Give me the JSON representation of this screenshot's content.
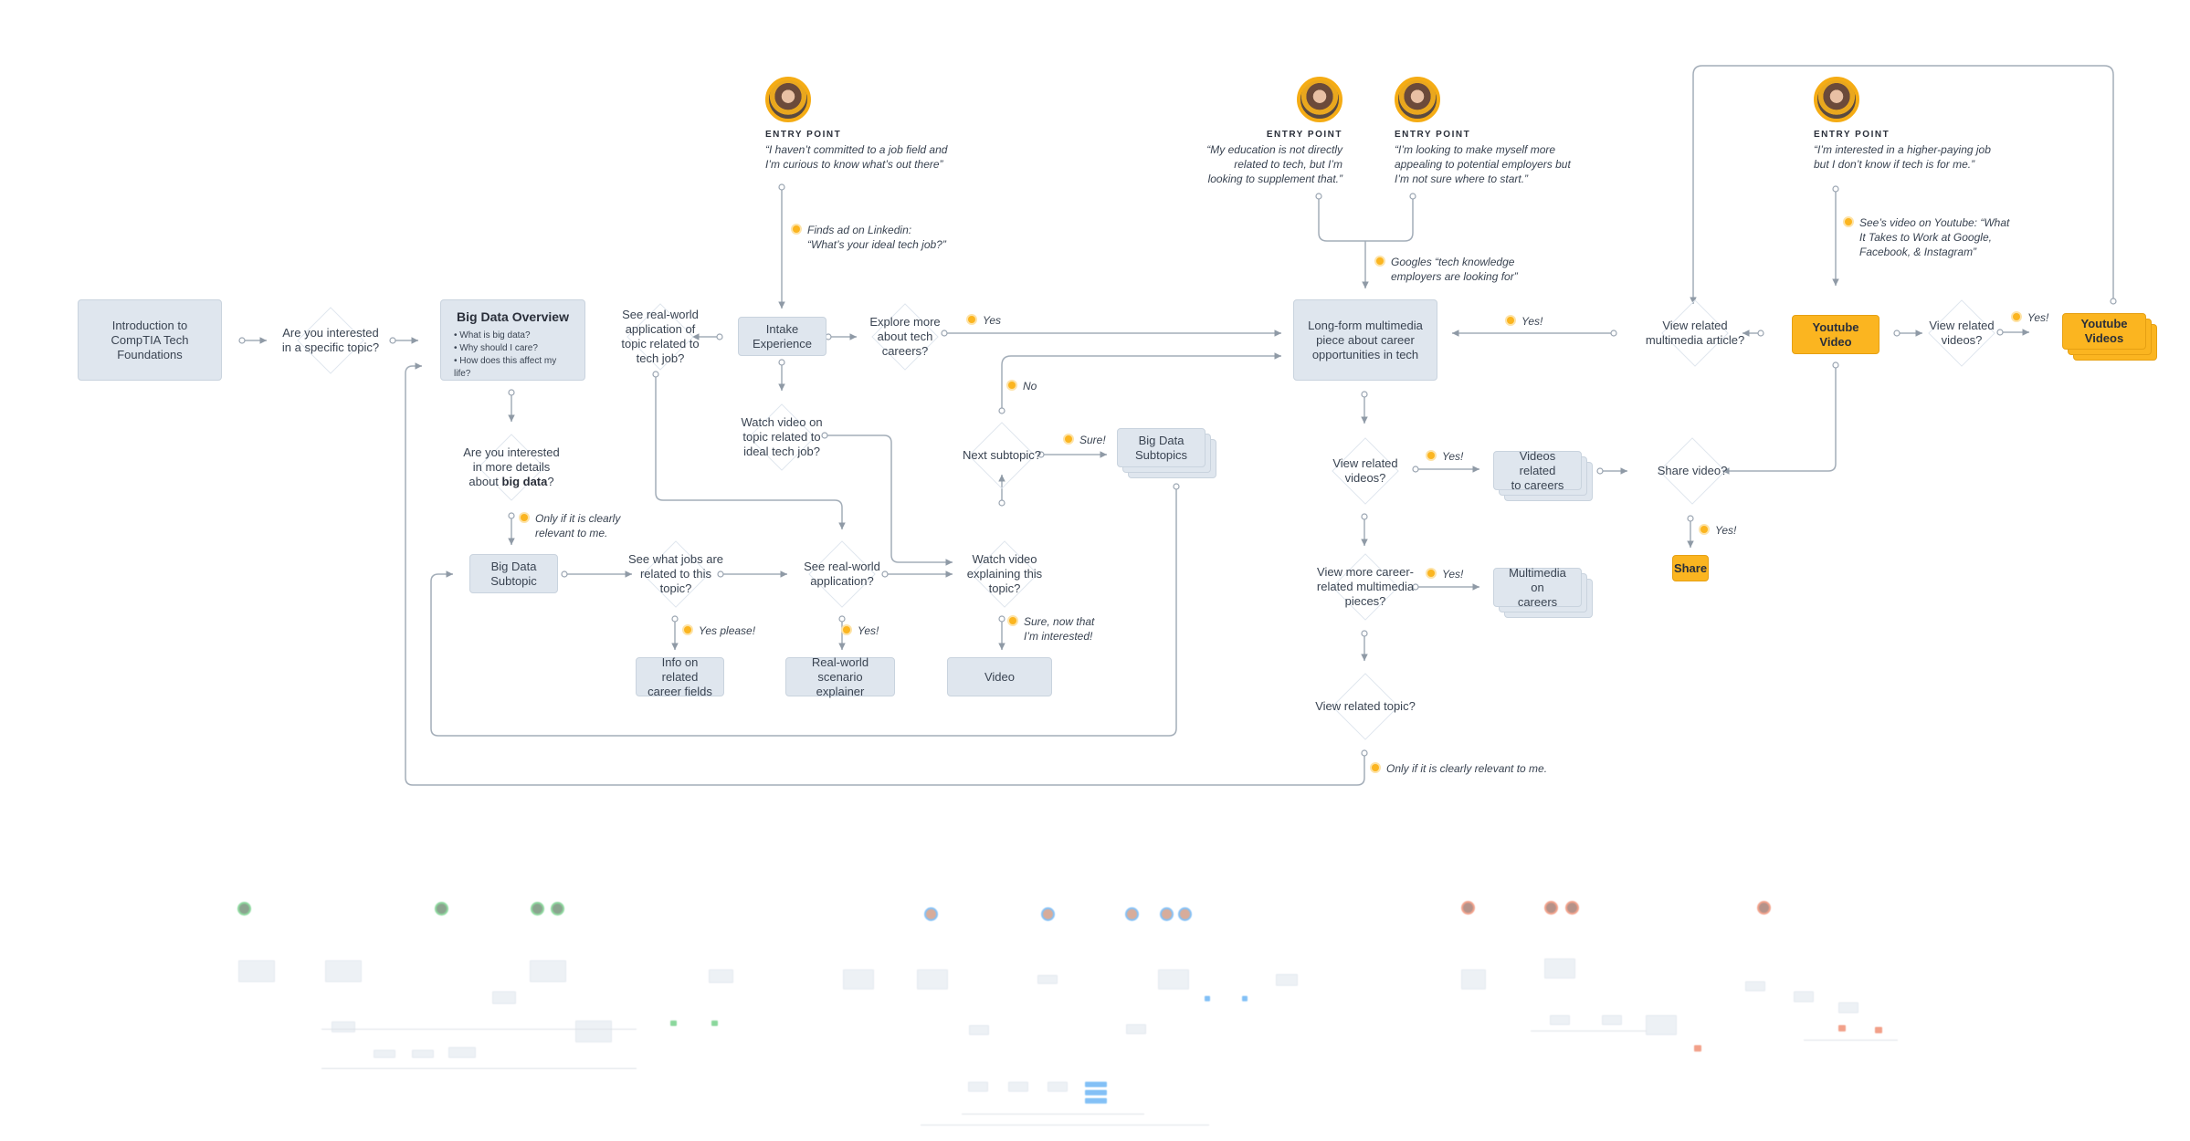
{
  "diagram": {
    "entry_points": [
      {
        "heading": "ENTRY POINT",
        "quote_lines": [
          "“I haven’t committed to a job field and",
          "I’m curious to know what’s out there”"
        ]
      },
      {
        "heading": "ENTRY POINT",
        "quote_lines": [
          "“My education is not directly",
          "related to tech, but I’m",
          "looking to supplement that.”"
        ]
      },
      {
        "heading": "ENTRY POINT",
        "quote_lines": [
          "“I’m looking to make myself more",
          "appealing to potential employers but",
          "I’m not sure where to start.”"
        ]
      },
      {
        "heading": "ENTRY POINT",
        "quote_lines": [
          "“I’m interested in a higher-paying job",
          "but I don’t know if tech is for me.”"
        ]
      }
    ],
    "nodes": {
      "intro": [
        "Introduction to",
        "CompTIA Tech",
        "Foundations"
      ],
      "overview_title": "Big Data Overview",
      "overview_bullets": [
        "What is big data?",
        "Why should I care?",
        "How does this affect my life?"
      ],
      "intake": [
        "Intake",
        "Experience"
      ],
      "bd_subtopic": [
        "Big Data",
        "Subtopic"
      ],
      "bd_subtopics": [
        "Big Data",
        "Subtopics"
      ],
      "info_careers": [
        "Info on related",
        "career fields"
      ],
      "realworld_explainer": [
        "Real-world",
        "scenario explainer"
      ],
      "video": "Video",
      "longform": [
        "Long-form multimedia",
        "piece about career",
        "opportunities in tech"
      ],
      "videos_careers": [
        "Videos related",
        "to careers"
      ],
      "multimedia_careers": [
        "Multimedia on",
        "careers"
      ],
      "youtube_video": "Youtube Video",
      "youtube_videos": "Youtube Videos",
      "share": "Share"
    },
    "decisions": {
      "specific_topic": [
        "Are you interested",
        "in a specific topic?"
      ],
      "more_details": [
        "Are you interested",
        "in more details",
        "about "
      ],
      "more_details_bold": "big data",
      "more_details_end": "?",
      "see_realworld_tech": [
        "See real-world",
        "application of",
        "topic related to",
        "tech job?"
      ],
      "explore_more": [
        "Explore more",
        "about tech",
        "careers?"
      ],
      "watch_video_ideal": [
        "Watch video on",
        "topic related to",
        "ideal tech job?"
      ],
      "next_subtopic": "Next subtopic?",
      "see_jobs": [
        "See what jobs are",
        "related to this",
        "topic?"
      ],
      "see_realworld": [
        "See real-world",
        "application?"
      ],
      "watch_explaining": [
        "Watch video",
        "explaining this",
        "topic?"
      ],
      "view_related_videos": [
        "View related",
        "videos?"
      ],
      "view_more_career": [
        "View more career-",
        "related multimedia",
        "pieces?"
      ],
      "view_related_topic": "View related topic?",
      "view_related_article": [
        "View related",
        "multimedia article?"
      ],
      "share_video": "Share video?",
      "view_related_videos_yt": [
        "View related",
        "videos?"
      ]
    },
    "labels": {
      "finds_ad": [
        "Finds ad on Linkedin:",
        "“What’s your ideal tech job?”"
      ],
      "googles": [
        "Googles “tech knowledge",
        "employers are looking for”"
      ],
      "sees_video": [
        "See’s video on Youtube: “What",
        "It Takes to Work at Google,",
        "Facebook, & Instagram”"
      ],
      "yes": "Yes",
      "no": "No",
      "sure": "Sure!",
      "only_if": [
        "Only if it is clearly",
        "relevant to me."
      ],
      "yes_please": "Yes please!",
      "yes_excl": "Yes!",
      "sure_now": [
        "Sure, now that",
        "I’m interested!"
      ],
      "yes_longform": "Yes!",
      "yes_videos": "Yes!",
      "yes_multimedia": "Yes!",
      "yes_share": "Yes!",
      "yes_yt_videos": "Yes!",
      "only_if_long": "Only if it is clearly relevant to me."
    },
    "colors": {
      "node_fill": "#dfe6ee",
      "accent": "#fbb520",
      "line": "#9aa5b1",
      "thumb_accent_1": "#2db84d",
      "thumb_accent_2": "#1e8ef0",
      "thumb_accent_3": "#e8542a"
    },
    "thumbnails": [
      {
        "name": "persona-map-green",
        "accent": "#2db84d"
      },
      {
        "name": "persona-map-blue",
        "accent": "#1e8ef0"
      },
      {
        "name": "persona-map-orange",
        "accent": "#e8542a"
      }
    ]
  }
}
